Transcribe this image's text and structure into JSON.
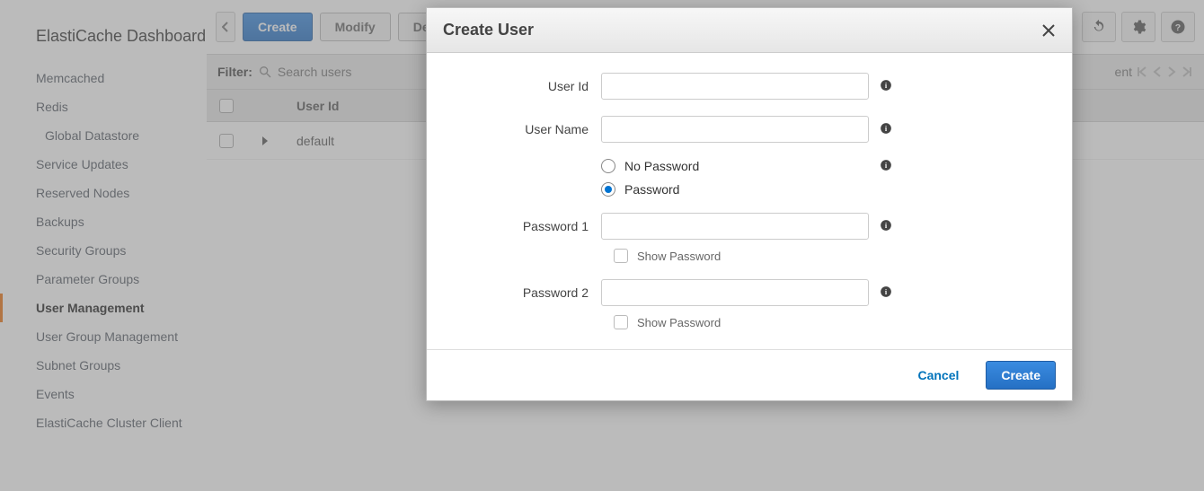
{
  "brand": "ElastiCache Dashboard",
  "sidebar": {
    "items": [
      {
        "label": "Memcached"
      },
      {
        "label": "Redis"
      },
      {
        "label": "Global Datastore",
        "sub": true
      },
      {
        "label": "Service Updates"
      },
      {
        "label": "Reserved Nodes"
      },
      {
        "label": "Backups"
      },
      {
        "label": "Security Groups"
      },
      {
        "label": "Parameter Groups"
      },
      {
        "label": "User Management",
        "active": true
      },
      {
        "label": "User Group Management"
      },
      {
        "label": "Subnet Groups"
      },
      {
        "label": "Events"
      },
      {
        "label": "ElastiCache Cluster Client"
      }
    ]
  },
  "toolbar": {
    "create_label": "Create",
    "modify_label": "Modify",
    "delete_label": "Delete"
  },
  "filter": {
    "label": "Filter:",
    "placeholder": "Search users",
    "pager_suffix": "ent"
  },
  "table": {
    "col_user_id": "User Id",
    "rows": [
      {
        "user_id": "default"
      }
    ]
  },
  "modal": {
    "title": "Create User",
    "fields": {
      "user_id_label": "User Id",
      "user_name_label": "User Name",
      "no_password_label": "No Password",
      "password_label": "Password",
      "password1_label": "Password 1",
      "password2_label": "Password 2",
      "show_password_label": "Show Password"
    },
    "password_mode": "password",
    "footer": {
      "cancel_label": "Cancel",
      "create_label": "Create"
    }
  }
}
